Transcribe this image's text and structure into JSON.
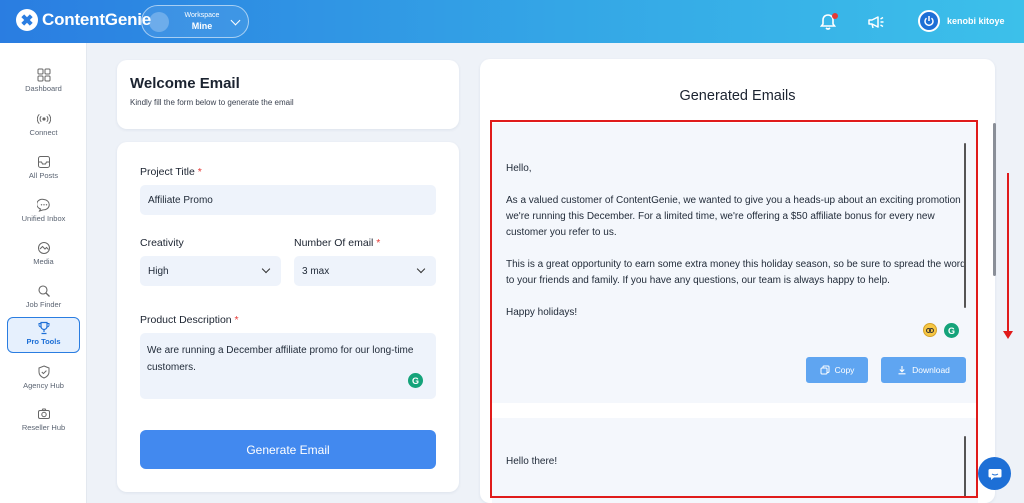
{
  "header": {
    "brand": "ContentGenie",
    "workspace": {
      "label": "Workspace",
      "value": "Mine"
    },
    "user_name": "kenobi kitoye"
  },
  "sidebar": {
    "items": [
      {
        "label": "Dashboard",
        "icon": "grid-icon",
        "active": false
      },
      {
        "label": "Connect",
        "icon": "broadcast-icon",
        "active": false
      },
      {
        "label": "All Posts",
        "icon": "inbox-icon",
        "active": false
      },
      {
        "label": "Unified Inbox",
        "icon": "chat-bubble-icon",
        "active": false
      },
      {
        "label": "Media",
        "icon": "media-icon",
        "active": false
      },
      {
        "label": "Job Finder",
        "icon": "search-doc-icon",
        "active": false
      },
      {
        "label": "Pro Tools",
        "icon": "trophy-icon",
        "active": true
      },
      {
        "label": "Agency Hub",
        "icon": "shield-icon",
        "active": false
      },
      {
        "label": "Reseller Hub",
        "icon": "camera-icon",
        "active": false
      }
    ]
  },
  "welcome": {
    "title": "Welcome Email",
    "subtitle": "Kindly fill the form below to generate the email"
  },
  "form": {
    "project_title": {
      "label": "Project Title",
      "required": "*",
      "value": "Affiliate Promo"
    },
    "creativity": {
      "label": "Creativity",
      "value": "High"
    },
    "number_of_email": {
      "label": "Number Of email",
      "required": "*",
      "value": "3 max"
    },
    "product_description": {
      "label": "Product Description",
      "required": "*",
      "value": "We are running a December affiliate promo for our long-time customers."
    },
    "generate_button": "Generate Email"
  },
  "generated": {
    "title": "Generated Emails",
    "emails": [
      {
        "paragraphs": [
          "Hello,",
          "As a valued customer of ContentGenie, we wanted to give you a heads-up about an exciting promotion we're running this December. For a limited time, we're offering a $50 affiliate bonus for every new customer you refer to us.",
          "This is a great opportunity to earn some extra money this holiday season, so be sure to spread the word to your friends and family. If you have any questions, our team is always happy to help.",
          "Happy holidays!"
        ],
        "copy_label": "Copy",
        "download_label": "Download"
      },
      {
        "paragraphs": [
          "Hello there!"
        ]
      }
    ]
  },
  "colors": {
    "primary": "#4289ef",
    "accent": "#2a7de1",
    "required": "#e53935",
    "highlight_frame": "#e01b1b",
    "grammarly": "#15a37a"
  }
}
